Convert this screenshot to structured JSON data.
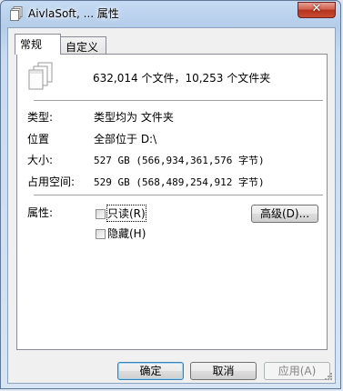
{
  "window": {
    "title": "AivlaSoft, ... 属性",
    "close_glyph": "✕"
  },
  "tabs": [
    {
      "label": "常规",
      "active": true
    },
    {
      "label": "自定义",
      "active": false
    }
  ],
  "general": {
    "summary": "632,014 个文件，10,253 个文件夹",
    "type_label": "类型:",
    "type_value": "类型均为 文件夹",
    "location_label": "位置",
    "location_value": "全部位于 D:\\",
    "size_label": "大小:",
    "size_value": "527 GB (566,934,361,576 字节)",
    "size_on_disk_label": "占用空间:",
    "size_on_disk_value": "529 GB (568,489,254,912 字节)",
    "attributes_label": "属性:",
    "readonly_label": "只读(R)",
    "hidden_label": "隐藏(H)",
    "advanced_button": "高级(D)..."
  },
  "buttons": {
    "ok": "确定",
    "cancel": "取消",
    "apply": "应用(A)"
  },
  "icons": {
    "title_icon": "folder-stack-icon",
    "summary_icon": "multiple-files-icon"
  }
}
